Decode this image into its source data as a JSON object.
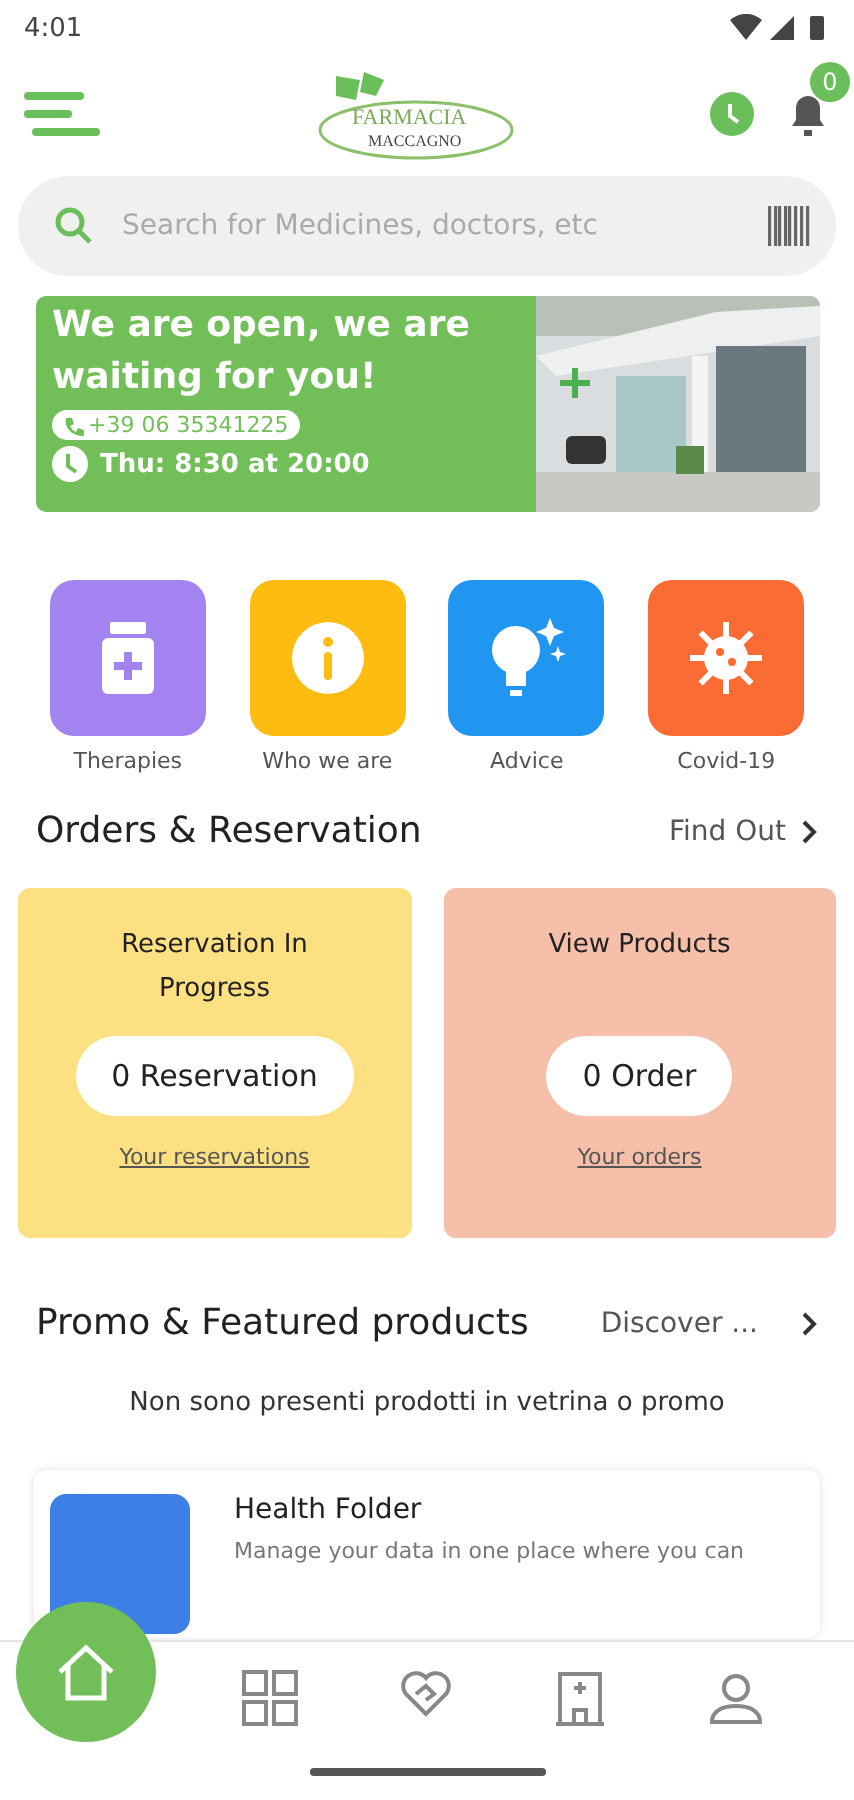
{
  "status_bar": {
    "time": "4:01"
  },
  "header": {
    "logo_top": "FARMACIA",
    "logo_bottom": "MACCAGNO",
    "notification_count": "0"
  },
  "search": {
    "placeholder": "Search for Medicines, doctors, etc"
  },
  "banner": {
    "title": "We are open, we are waiting for you!",
    "phone": "+39 06 35341225",
    "hours": "Thu: 8:30 at 20:00"
  },
  "categories": [
    {
      "label": "Therapies",
      "kind": "jar",
      "color": "#a283f0"
    },
    {
      "label": "Who we are",
      "kind": "info",
      "color": "#fdbc0f"
    },
    {
      "label": "Advice",
      "kind": "bulb",
      "color": "#2196f0"
    },
    {
      "label": "Covid-19",
      "kind": "virus",
      "color": "#fb6c35"
    }
  ],
  "orders": {
    "title": "Orders & Reservation",
    "link": "Find Out",
    "cards": [
      {
        "title": "Reservation In Progress",
        "count": "0 Reservation",
        "link": "Your reservations",
        "color": "#fde082"
      },
      {
        "title": "View Products",
        "count": "0 Order",
        "link": "Your orders",
        "color": "#f6bfa9"
      }
    ]
  },
  "promo": {
    "title": "Promo & Featured products",
    "link": "Discover ...",
    "empty": "Non sono presenti prodotti in vetrina o promo"
  },
  "health_folder": {
    "title": "Health Folder",
    "description": "Manage your data in one place where you can"
  },
  "bottom_nav": [
    {
      "kind": "home",
      "selected": true
    },
    {
      "kind": "grid",
      "selected": false
    },
    {
      "kind": "heart",
      "selected": false
    },
    {
      "kind": "pharmacy",
      "selected": false
    },
    {
      "kind": "profile",
      "selected": false
    }
  ]
}
